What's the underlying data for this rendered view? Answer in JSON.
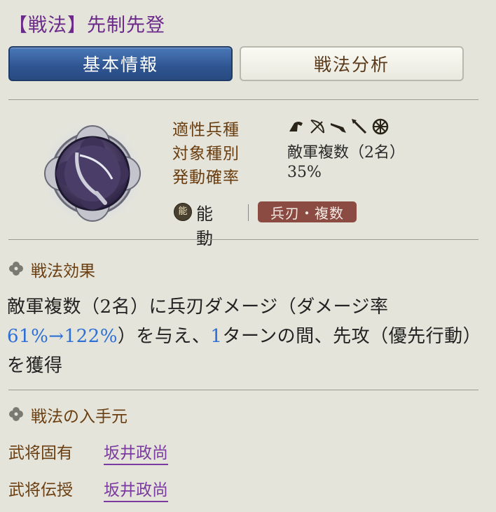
{
  "title": "【戦法】先制先登",
  "tabs": [
    {
      "label": "基本情報",
      "active": true
    },
    {
      "label": "戦法分析",
      "active": false
    }
  ],
  "info": {
    "suitable_troops_label": "適性兵種",
    "troop_icons": [
      "cavalry-icon",
      "archer-icon",
      "gun-icon",
      "spear-icon",
      "shield-icon"
    ],
    "target_label": "対象種別",
    "target_value": "敵軍複数（2名）",
    "rate_label": "発動確率",
    "rate_value": "35%"
  },
  "activation": {
    "icon_text": "能",
    "type": "能動",
    "tag": "兵刃・複数"
  },
  "effect": {
    "heading": "戦法効果",
    "part1": "敵軍複数（2名）に兵刃ダメージ（ダメージ率",
    "rate": "61%→122%",
    "part2": "）を与え、",
    "turns": "1",
    "part3": "ターンの間、先攻（優先行動）を獲得"
  },
  "source": {
    "heading": "戦法の入手元",
    "rows": [
      {
        "label": "武将固有",
        "value": "坂井政尚"
      },
      {
        "label": "武将伝授",
        "value": "坂井政尚"
      }
    ]
  },
  "colors": {
    "background": "#e4e4da",
    "title": "#6b2a8a",
    "label": "#6a3e10",
    "accent_blue": "#2d6fd6",
    "tab_active": "#2f5591",
    "tag_bg": "#8b4a42",
    "link": "#7a3aa0"
  }
}
